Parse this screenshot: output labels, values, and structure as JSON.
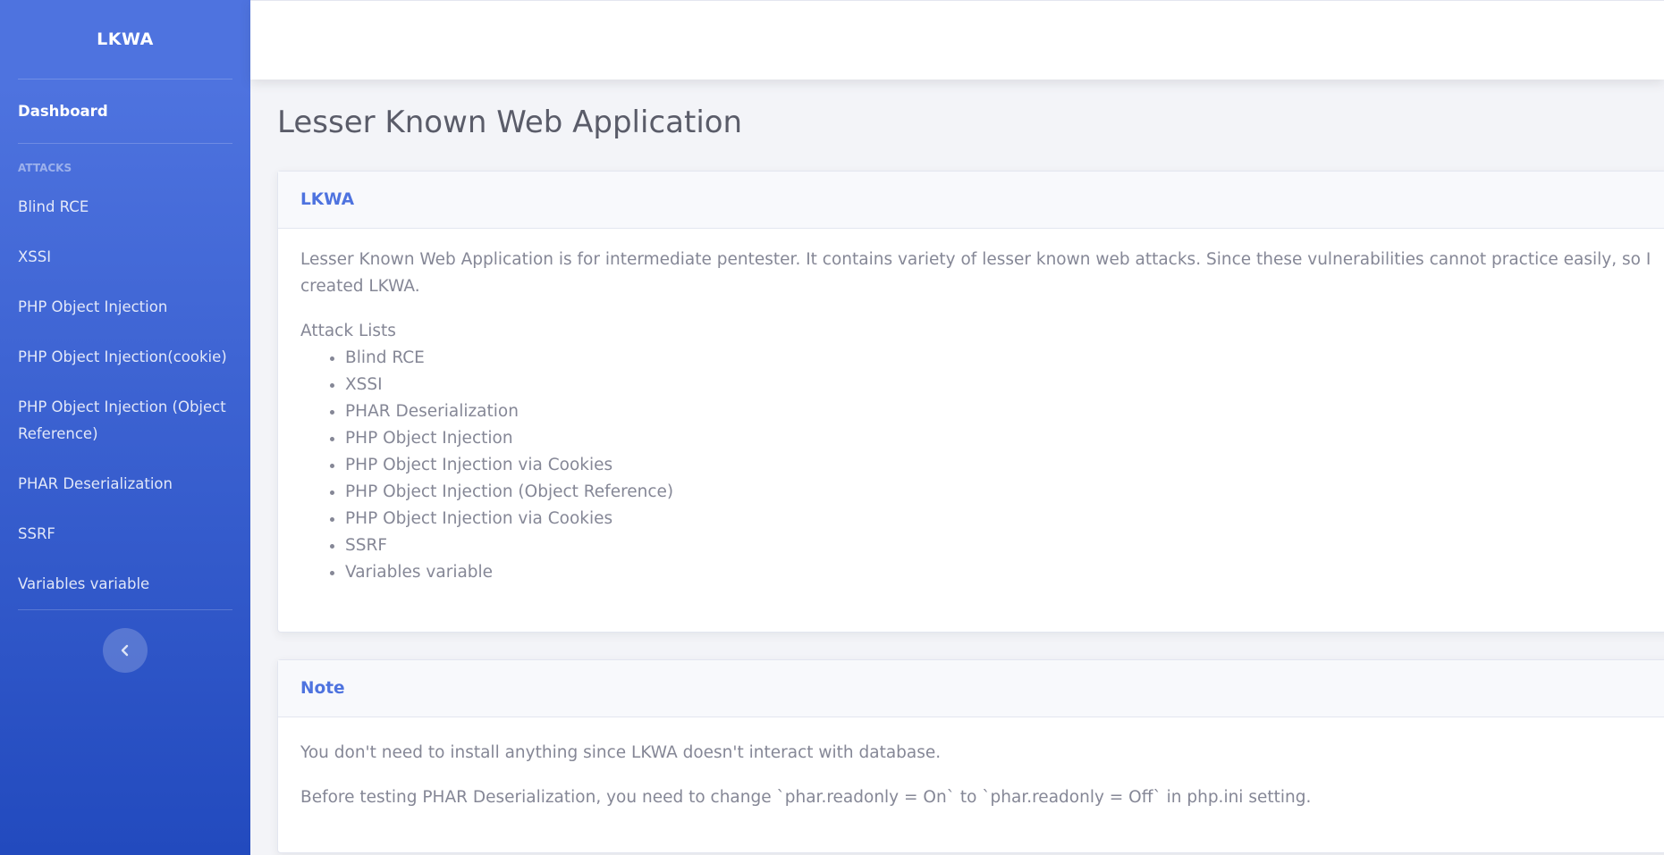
{
  "sidebar": {
    "brand": "LKWA",
    "dashboard": "Dashboard",
    "heading": "ATTACKS",
    "items": [
      "Blind RCE",
      "XSSI",
      "PHP Object Injection",
      "PHP Object Injection(cookie)",
      "PHP Object Injection (Object Reference)",
      "PHAR Deserialization",
      "SSRF",
      "Variables variable"
    ],
    "toggle_icon": "chevron-left-icon"
  },
  "page": {
    "title": "Lesser Known Web Application"
  },
  "card_intro": {
    "header": "LKWA",
    "description": "Lesser Known Web Application is for intermediate pentester. It contains variety of lesser known web attacks. Since these vulnerabilities cannot practice easily, so I created LKWA.",
    "list_title": "Attack Lists",
    "list": [
      "Blind RCE",
      "XSSI",
      "PHAR Deserialization",
      "PHP Object Injection",
      "PHP Object Injection via Cookies",
      "PHP Object Injection (Object Reference)",
      "PHP Object Injection via Cookies",
      "SSRF",
      "Variables variable"
    ]
  },
  "card_note": {
    "header": "Note",
    "line1": "You don't need to install anything since LKWA doesn't interact with database.",
    "line2": "Before testing PHAR Deserialization, you need to change `phar.readonly = On` to `phar.readonly = Off` in php.ini setting."
  },
  "colors": {
    "primary": "#4e73df",
    "sidebar_bottom": "#224abe",
    "text": "#858796",
    "title": "#5a5c69"
  }
}
